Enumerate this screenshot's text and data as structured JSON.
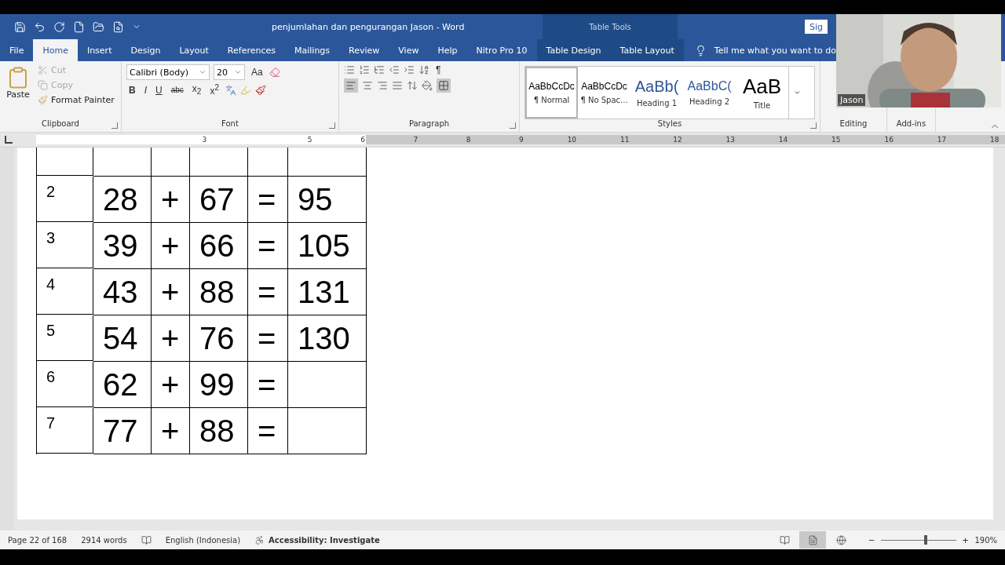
{
  "title_bar": {
    "document_title": "penjumlahan dan pengurangan Jason  -  Word",
    "context_label": "Table Tools",
    "sign_in": "Sig"
  },
  "tabs": [
    {
      "label": "File",
      "selected": false,
      "kind": "file"
    },
    {
      "label": "Home",
      "selected": true,
      "kind": "main"
    },
    {
      "label": "Insert",
      "selected": false,
      "kind": "main"
    },
    {
      "label": "Design",
      "selected": false,
      "kind": "main"
    },
    {
      "label": "Layout",
      "selected": false,
      "kind": "main"
    },
    {
      "label": "References",
      "selected": false,
      "kind": "main"
    },
    {
      "label": "Mailings",
      "selected": false,
      "kind": "main"
    },
    {
      "label": "Review",
      "selected": false,
      "kind": "main"
    },
    {
      "label": "View",
      "selected": false,
      "kind": "main"
    },
    {
      "label": "Help",
      "selected": false,
      "kind": "main"
    },
    {
      "label": "Nitro Pro 10",
      "selected": false,
      "kind": "main"
    },
    {
      "label": "Table Design",
      "selected": false,
      "kind": "contextual"
    },
    {
      "label": "Table Layout",
      "selected": false,
      "kind": "contextual"
    }
  ],
  "tell_me": "Tell me what you want to do",
  "clipboard": {
    "label": "Clipboard",
    "paste": "Paste",
    "cut": {
      "label": "Cut",
      "disabled": true
    },
    "copy": {
      "label": "Copy",
      "disabled": true
    },
    "format_painter": "Format Painter"
  },
  "font": {
    "label": "Font",
    "font_name": "Calibri (Body)",
    "font_size": "20",
    "change_case": "Aa",
    "bold": "B",
    "italic": "I",
    "underline": "U",
    "strikethrough": "abc",
    "subscript": "x$_{2}$",
    "superscript": "x$^{2}$"
  },
  "paragraph": {
    "label": "Paragraph",
    "pilcrow": "¶"
  },
  "styles": {
    "label": "Styles",
    "items": [
      {
        "preview": "AaBbCcDc",
        "name": "¶ Normal",
        "selected": true,
        "kind": "normal"
      },
      {
        "preview": "AaBbCcDc",
        "name": "¶ No Spac...",
        "selected": false,
        "kind": "normal"
      },
      {
        "preview": "AaBb(",
        "name": "Heading 1",
        "selected": false,
        "kind": "heading1"
      },
      {
        "preview": "AaBbC(",
        "name": "Heading 2",
        "selected": false,
        "kind": "heading2"
      },
      {
        "preview": "AaB",
        "name": "Title",
        "selected": false,
        "kind": "title"
      }
    ]
  },
  "editing": {
    "label": "Editing"
  },
  "addins": {
    "label": "Add-ins"
  },
  "ruler": {
    "left_numbers": [
      "3"
    ],
    "right_numbers": [
      "5",
      "6",
      "7",
      "8",
      "9",
      "10",
      "11",
      "12",
      "13",
      "14",
      "15",
      "16",
      "17",
      "18"
    ]
  },
  "table": {
    "rows": [
      {
        "kind": "cut_off",
        "cells": []
      },
      {
        "number": "2",
        "cells": [
          "28",
          "+",
          "67",
          "=",
          "95"
        ]
      },
      {
        "number": "3",
        "cells": [
          "39",
          "+",
          "66",
          "=",
          "105"
        ]
      },
      {
        "number": "4",
        "cells": [
          "43",
          "+",
          "88",
          "=",
          "131"
        ]
      },
      {
        "number": "5",
        "cells": [
          "54",
          "+",
          "76",
          "=",
          "130"
        ]
      },
      {
        "number": "6",
        "cells": [
          "62",
          "+",
          "99",
          "="
        ]
      },
      {
        "number": "7",
        "cells": [
          "77",
          "+",
          "88",
          "="
        ]
      }
    ]
  },
  "status_bar": {
    "page": "Page 22 of 168",
    "words": "2914 words",
    "language": "English (Indonesia)",
    "accessibility": "Accessibility: Investigate",
    "views": [
      {
        "kind": "read",
        "selected": false
      },
      {
        "kind": "print",
        "selected": true
      },
      {
        "kind": "web",
        "selected": false
      }
    ],
    "zoom": {
      "minus": "−",
      "plus": "+",
      "level": 0.6,
      "reading": "190%"
    }
  },
  "webcam": {
    "kind": "picture",
    "name": "Jason"
  }
}
